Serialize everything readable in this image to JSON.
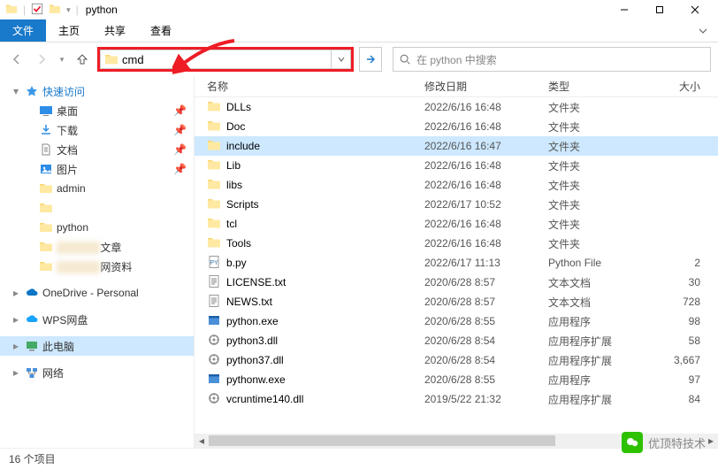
{
  "titlebar": {
    "title": "python"
  },
  "ribbon": {
    "file": "文件",
    "home": "主页",
    "share": "共享",
    "view": "查看"
  },
  "address": {
    "value": "cmd",
    "refresh_tip": "→"
  },
  "search": {
    "placeholder": "在 python 中搜索"
  },
  "sidebar": {
    "quick_access": "快速访问",
    "desktop": "桌面",
    "downloads": "下载",
    "documents": "文档",
    "pictures": "图片",
    "admin": "admin",
    "blur1": "         ",
    "python": "python",
    "blur2": "文章",
    "blur3": "网资料",
    "onedrive": "OneDrive - Personal",
    "wps": "WPS网盘",
    "this_pc": "此电脑",
    "network": "网络"
  },
  "columns": {
    "name": "名称",
    "date": "修改日期",
    "type": "类型",
    "size": "大小"
  },
  "files": [
    {
      "icon": "folder",
      "name": "DLLs",
      "date": "2022/6/16 16:48",
      "type": "文件夹",
      "size": ""
    },
    {
      "icon": "folder",
      "name": "Doc",
      "date": "2022/6/16 16:48",
      "type": "文件夹",
      "size": ""
    },
    {
      "icon": "folder",
      "name": "include",
      "date": "2022/6/16 16:47",
      "type": "文件夹",
      "size": "",
      "selected": true
    },
    {
      "icon": "folder",
      "name": "Lib",
      "date": "2022/6/16 16:48",
      "type": "文件夹",
      "size": ""
    },
    {
      "icon": "folder",
      "name": "libs",
      "date": "2022/6/16 16:48",
      "type": "文件夹",
      "size": ""
    },
    {
      "icon": "folder",
      "name": "Scripts",
      "date": "2022/6/17 10:52",
      "type": "文件夹",
      "size": ""
    },
    {
      "icon": "folder",
      "name": "tcl",
      "date": "2022/6/16 16:48",
      "type": "文件夹",
      "size": ""
    },
    {
      "icon": "folder",
      "name": "Tools",
      "date": "2022/6/16 16:48",
      "type": "文件夹",
      "size": ""
    },
    {
      "icon": "py",
      "name": "b.py",
      "date": "2022/6/17 11:13",
      "type": "Python File",
      "size": "2"
    },
    {
      "icon": "txt",
      "name": "LICENSE.txt",
      "date": "2020/6/28 8:57",
      "type": "文本文档",
      "size": "30"
    },
    {
      "icon": "txt",
      "name": "NEWS.txt",
      "date": "2020/6/28 8:57",
      "type": "文本文档",
      "size": "728"
    },
    {
      "icon": "exe",
      "name": "python.exe",
      "date": "2020/6/28 8:55",
      "type": "应用程序",
      "size": "98"
    },
    {
      "icon": "dll",
      "name": "python3.dll",
      "date": "2020/6/28 8:54",
      "type": "应用程序扩展",
      "size": "58"
    },
    {
      "icon": "dll",
      "name": "python37.dll",
      "date": "2020/6/28 8:54",
      "type": "应用程序扩展",
      "size": "3,667"
    },
    {
      "icon": "exe",
      "name": "pythonw.exe",
      "date": "2020/6/28 8:55",
      "type": "应用程序",
      "size": "97"
    },
    {
      "icon": "dll",
      "name": "vcruntime140.dll",
      "date": "2019/5/22 21:32",
      "type": "应用程序扩展",
      "size": "84"
    }
  ],
  "status": {
    "count": "16 个项目"
  },
  "watermark": {
    "text": "优顶特技术"
  }
}
